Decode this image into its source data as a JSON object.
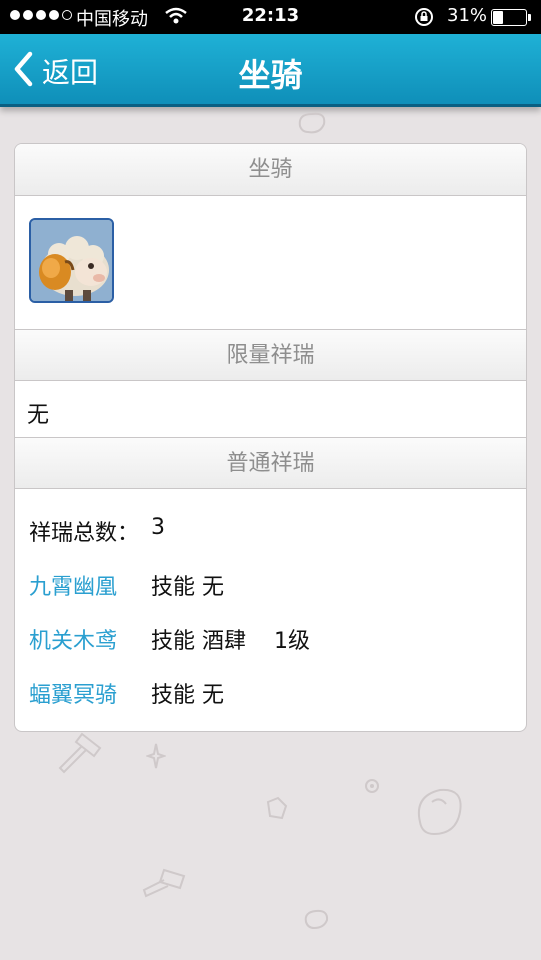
{
  "status_bar": {
    "carrier": "中国移动",
    "time": "22:13",
    "battery_percent": "31%",
    "battery_level": 0.31,
    "signal_bars_filled": 4,
    "signal_bars_total": 5
  },
  "nav": {
    "back_label": "返回",
    "title": "坐骑"
  },
  "card": {
    "mount_header": "坐骑",
    "limited_header": "限量祥瑞",
    "limited_value": "无",
    "normal_header": "普通祥瑞",
    "total_label": "祥瑞总数：",
    "total_value": "3",
    "items": [
      {
        "name": "九霄幽凰",
        "detail": "技能 无"
      },
      {
        "name": "机关木鸢",
        "detail": "技能 酒肆    1级"
      },
      {
        "name": "蝠翼冥骑",
        "detail": "技能 无"
      }
    ]
  },
  "colors": {
    "nav_bar": "#1aa6cf",
    "link_text": "#2a9fd0",
    "header_text": "#8e8e8e",
    "background": "#e7e3e4"
  }
}
